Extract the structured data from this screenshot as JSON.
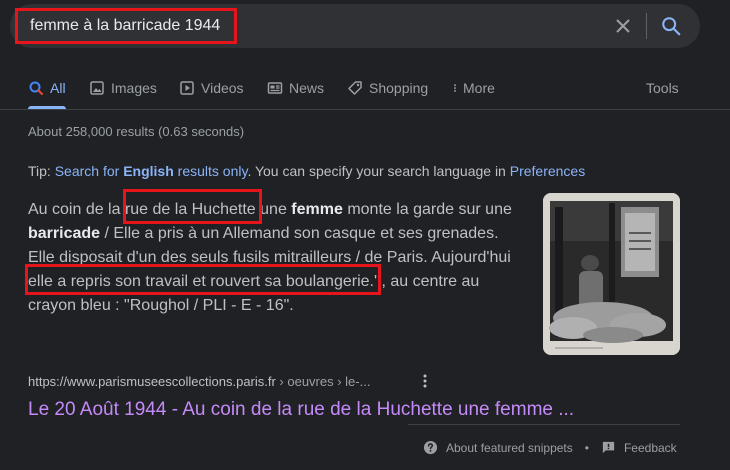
{
  "search": {
    "query": "femme à la barricade 1944"
  },
  "tabs": [
    {
      "label": "All",
      "icon": "search-icon",
      "active": true
    },
    {
      "label": "Images",
      "icon": "image-icon"
    },
    {
      "label": "Videos",
      "icon": "play-icon"
    },
    {
      "label": "News",
      "icon": "news-icon"
    },
    {
      "label": "Shopping",
      "icon": "tag-icon"
    },
    {
      "label": "More",
      "icon": "vertical-dots-icon"
    }
  ],
  "tools_label": "Tools",
  "stats": "About 258,000 results (0.63 seconds)",
  "tip": {
    "prefix": "Tip: ",
    "search_for": "Search for ",
    "english": "English",
    "results_only": " results only",
    "middle": ". You can specify your search language in ",
    "preferences": "Preferences"
  },
  "snippet": {
    "l1a": "Au coin de la ",
    "l1b": "rue de la Huchette",
    "l1c": " une ",
    "l1d": "femme",
    "l1e": " monte la garde sur une",
    "l2a": "barricade",
    "l2b": " / Elle a pris à un Allemand son casque et ses grenades.",
    "l3": "Elle disposait d'un des seuls fusils mitrailleurs / de Paris. Aujourd'hui",
    "l4a": "elle a repris son travail et rouvert sa boulangerie.'",
    "l4b": " , au centre au",
    "l5": "crayon bleu : \"Roughol / PLI - E - 16\"."
  },
  "result": {
    "domain": "https://www.parismuseescollections.paris.fr",
    "path": " › oeuvres › le-...",
    "title": "Le 20 Août 1944 - Au coin de la rue de la Huchette une femme ..."
  },
  "footer": {
    "about": "About featured snippets",
    "separator": "•",
    "feedback": "Feedback"
  },
  "colors": {
    "background": "#202124",
    "link": "#8ab4f8",
    "visited": "#c58af9",
    "highlight": "#e8141b"
  }
}
